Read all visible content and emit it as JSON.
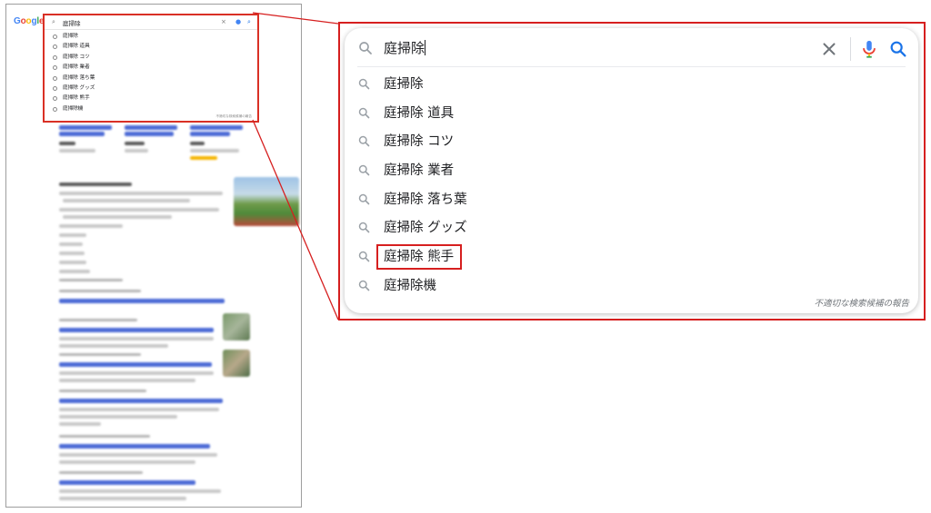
{
  "page": {
    "logo": "Google",
    "logo_colors": [
      "#4285F4",
      "#EA4335",
      "#FBBC05",
      "#4285F4",
      "#34A853",
      "#EA4335"
    ]
  },
  "search": {
    "query": "庭掃除",
    "suggestions": [
      {
        "label": "庭掃除",
        "highlighted": false
      },
      {
        "label": "庭掃除 道具",
        "highlighted": false
      },
      {
        "label": "庭掃除 コツ",
        "highlighted": false
      },
      {
        "label": "庭掃除 業者",
        "highlighted": false
      },
      {
        "label": "庭掃除 落ち葉",
        "highlighted": false
      },
      {
        "label": "庭掃除 グッズ",
        "highlighted": false
      },
      {
        "label": "庭掃除 熊手",
        "highlighted": true
      },
      {
        "label": "庭掃除機",
        "highlighted": false
      }
    ],
    "report_link": "不適切な検索候補の報告"
  },
  "colors": {
    "highlight": "#d61f1f",
    "search_icon": "#1a73e8",
    "mic_blue": "#4285F4",
    "mic_red": "#EA4335",
    "mic_yellow": "#FBBC05",
    "mic_green": "#34A853"
  }
}
